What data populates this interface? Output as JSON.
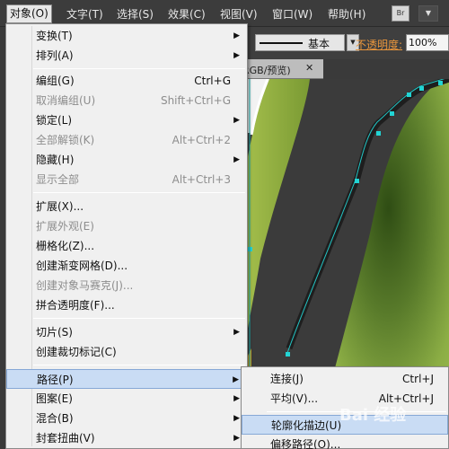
{
  "menubar": {
    "items": [
      "对象(O)",
      "文字(T)",
      "选择(S)",
      "效果(C)",
      "视图(V)",
      "窗口(W)",
      "帮助(H)"
    ],
    "br_button": "Br"
  },
  "controlbar": {
    "stroke_style_label": "基本",
    "opacity_label": "不透明度:",
    "opacity_value": "100%"
  },
  "document_tab": {
    "label": "RGB/预览)",
    "close_glyph": "✕"
  },
  "object_menu": {
    "items": [
      {
        "label": "变换(T)",
        "shortcut": "",
        "submenu": true,
        "disabled": false
      },
      {
        "label": "排列(A)",
        "shortcut": "",
        "submenu": true,
        "disabled": false
      },
      {
        "label": "编组(G)",
        "shortcut": "Ctrl+G",
        "submenu": false,
        "disabled": false
      },
      {
        "label": "取消编组(U)",
        "shortcut": "Shift+Ctrl+G",
        "submenu": false,
        "disabled": true
      },
      {
        "label": "锁定(L)",
        "shortcut": "",
        "submenu": true,
        "disabled": false
      },
      {
        "label": "全部解锁(K)",
        "shortcut": "Alt+Ctrl+2",
        "submenu": false,
        "disabled": true
      },
      {
        "label": "隐藏(H)",
        "shortcut": "",
        "submenu": true,
        "disabled": false
      },
      {
        "label": "显示全部",
        "shortcut": "Alt+Ctrl+3",
        "submenu": false,
        "disabled": true
      },
      {
        "label": "扩展(X)...",
        "shortcut": "",
        "submenu": false,
        "disabled": false
      },
      {
        "label": "扩展外观(E)",
        "shortcut": "",
        "submenu": false,
        "disabled": true
      },
      {
        "label": "栅格化(Z)...",
        "shortcut": "",
        "submenu": false,
        "disabled": false
      },
      {
        "label": "创建渐变网格(D)...",
        "shortcut": "",
        "submenu": false,
        "disabled": false
      },
      {
        "label": "创建对象马赛克(J)...",
        "shortcut": "",
        "submenu": false,
        "disabled": true
      },
      {
        "label": "拼合透明度(F)...",
        "shortcut": "",
        "submenu": false,
        "disabled": false
      },
      {
        "label": "切片(S)",
        "shortcut": "",
        "submenu": true,
        "disabled": false
      },
      {
        "label": "创建裁切标记(C)",
        "shortcut": "",
        "submenu": false,
        "disabled": false
      },
      {
        "label": "路径(P)",
        "shortcut": "",
        "submenu": true,
        "disabled": false,
        "highlight": true
      },
      {
        "label": "图案(E)",
        "shortcut": "",
        "submenu": true,
        "disabled": false
      },
      {
        "label": "混合(B)",
        "shortcut": "",
        "submenu": true,
        "disabled": false
      },
      {
        "label": "封套扭曲(V)",
        "shortcut": "",
        "submenu": true,
        "disabled": false
      }
    ]
  },
  "path_submenu": {
    "items": [
      {
        "label": "连接(J)",
        "shortcut": "Ctrl+J"
      },
      {
        "label": "平均(V)...",
        "shortcut": "Alt+Ctrl+J"
      },
      {
        "label": "轮廓化描边(U)",
        "shortcut": "",
        "highlight": true
      },
      {
        "label": "偏移路径(O)...",
        "shortcut": ""
      }
    ]
  },
  "watermark": "Bai 经验"
}
